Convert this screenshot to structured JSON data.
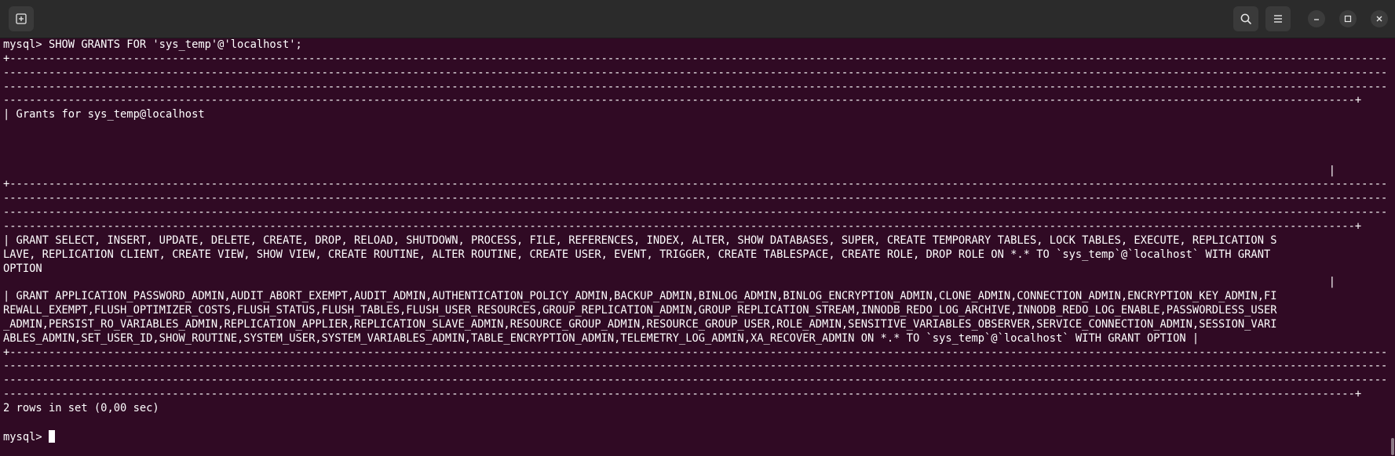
{
  "titlebar": {
    "icons": [
      "new-tab-icon",
      "search-icon",
      "hamburger-menu-icon",
      "minimize-icon",
      "maximize-icon",
      "close-icon"
    ]
  },
  "colors": {
    "terminal_background": "#300a24",
    "terminal_text": "#ffffff",
    "titlebar_background": "#2b2b2b"
  },
  "terminal": {
    "prompt": "mysql> ",
    "lines": [
      "mysql> SHOW GRANTS FOR 'sys_temp'@'localhost';",
      "+-----------------------------------------------------------------------------------------------------------------------------------------------------------------------------------------------------------------------------------------",
      "-----------------------------------------------------------------------------------------------------------------------------------------------------------------------------------------------------------------------------------------",
      "-----------------------------------------------------------------------------------------------------------------------------------------------------------------------------------------------------------------------------------------",
      "----------------------------------------------------------------------------------------------------------------------------------------------------------------------------------------------------------------+",
      "| Grants for sys_temp@localhost",
      "",
      "",
      "",
      "                                                                                                                                                                                                            |",
      "+-----------------------------------------------------------------------------------------------------------------------------------------------------------------------------------------------------------------------------------------",
      "-----------------------------------------------------------------------------------------------------------------------------------------------------------------------------------------------------------------------------------------",
      "-----------------------------------------------------------------------------------------------------------------------------------------------------------------------------------------------------------------------------------------",
      "----------------------------------------------------------------------------------------------------------------------------------------------------------------------------------------------------------------+",
      "| GRANT SELECT, INSERT, UPDATE, DELETE, CREATE, DROP, RELOAD, SHUTDOWN, PROCESS, FILE, REFERENCES, INDEX, ALTER, SHOW DATABASES, SUPER, CREATE TEMPORARY TABLES, LOCK TABLES, EXECUTE, REPLICATION S",
      "LAVE, REPLICATION CLIENT, CREATE VIEW, SHOW VIEW, CREATE ROUTINE, ALTER ROUTINE, CREATE USER, EVENT, TRIGGER, CREATE TABLESPACE, CREATE ROLE, DROP ROLE ON *.* TO `sys_temp`@`localhost` WITH GRANT",
      "OPTION",
      "                                                                                                                                                                                                            |",
      "| GRANT APPLICATION_PASSWORD_ADMIN,AUDIT_ABORT_EXEMPT,AUDIT_ADMIN,AUTHENTICATION_POLICY_ADMIN,BACKUP_ADMIN,BINLOG_ADMIN,BINLOG_ENCRYPTION_ADMIN,CLONE_ADMIN,CONNECTION_ADMIN,ENCRYPTION_KEY_ADMIN,FI",
      "REWALL_EXEMPT,FLUSH_OPTIMIZER_COSTS,FLUSH_STATUS,FLUSH_TABLES,FLUSH_USER_RESOURCES,GROUP_REPLICATION_ADMIN,GROUP_REPLICATION_STREAM,INNODB_REDO_LOG_ARCHIVE,INNODB_REDO_LOG_ENABLE,PASSWORDLESS_USER",
      "_ADMIN,PERSIST_RO_VARIABLES_ADMIN,REPLICATION_APPLIER,REPLICATION_SLAVE_ADMIN,RESOURCE_GROUP_ADMIN,RESOURCE_GROUP_USER,ROLE_ADMIN,SENSITIVE_VARIABLES_OBSERVER,SERVICE_CONNECTION_ADMIN,SESSION_VARI",
      "ABLES_ADMIN,SET_USER_ID,SHOW_ROUTINE,SYSTEM_USER,SYSTEM_VARIABLES_ADMIN,TABLE_ENCRYPTION_ADMIN,TELEMETRY_LOG_ADMIN,XA_RECOVER_ADMIN ON *.* TO `sys_temp`@`localhost` WITH GRANT OPTION |",
      "+-----------------------------------------------------------------------------------------------------------------------------------------------------------------------------------------------------------------------------------------",
      "-----------------------------------------------------------------------------------------------------------------------------------------------------------------------------------------------------------------------------------------",
      "-----------------------------------------------------------------------------------------------------------------------------------------------------------------------------------------------------------------------------------------",
      "----------------------------------------------------------------------------------------------------------------------------------------------------------------------------------------------------------------+",
      "2 rows in set (0,00 sec)",
      ""
    ]
  }
}
